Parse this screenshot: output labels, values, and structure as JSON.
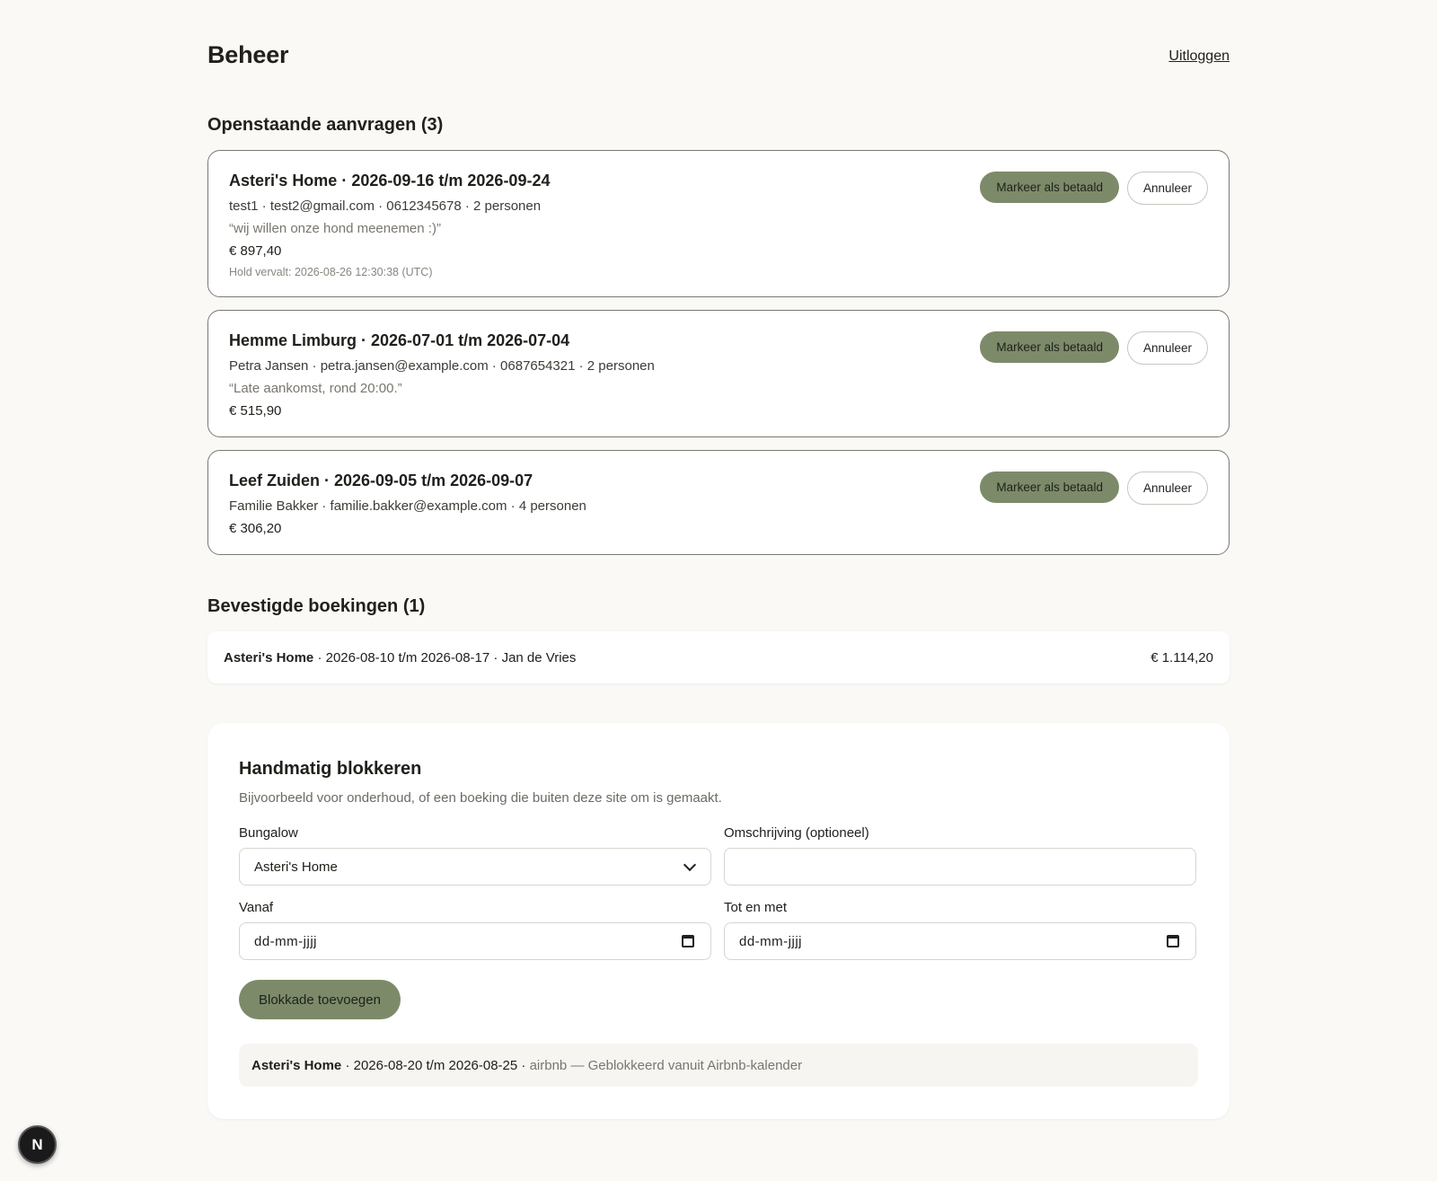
{
  "header": {
    "title": "Beheer",
    "logout_label": "Uitloggen"
  },
  "pending": {
    "title": "Openstaande aanvragen (3)",
    "mark_paid_label": "Markeer als betaald",
    "cancel_label": "Annuleer",
    "items": [
      {
        "title": "Asteri's Home · 2026-09-16 t/m 2026-09-24",
        "contact": "test1 · test2@gmail.com · 0612345678 · 2 personen",
        "note": "“wij willen onze hond meenemen :)”",
        "price": "€ 897,40",
        "hold": "Hold vervalt: 2026-08-26 12:30:38 (UTC)"
      },
      {
        "title": "Hemme Limburg · 2026-07-01 t/m 2026-07-04",
        "contact": "Petra Jansen · petra.jansen@example.com · 0687654321 · 2 personen",
        "note": "“Late aankomst, rond 20:00.”",
        "price": "€ 515,90"
      },
      {
        "title": "Leef Zuiden · 2026-09-05 t/m 2026-09-07",
        "contact": "Familie Bakker · familie.bakker@example.com · 4 personen",
        "price": "€ 306,20"
      }
    ]
  },
  "confirmed": {
    "title": "Bevestigde boekingen (1)",
    "items": [
      {
        "name": "Asteri's Home",
        "details": " · 2026-08-10 t/m 2026-08-17 · Jan de Vries",
        "price": "€ 1.114,20"
      }
    ]
  },
  "block": {
    "title": "Handmatig blokkeren",
    "description": "Bijvoorbeeld voor onderhoud, of een boeking die buiten deze site om is gemaakt.",
    "bungalow_label": "Bungalow",
    "bungalow_value": "Asteri's Home",
    "description_label": "Omschrijving (optioneel)",
    "description_value": "",
    "from_label": "Vanaf",
    "from_placeholder": "dd-mm-jjjj",
    "to_label": "Tot en met",
    "to_placeholder": "dd-mm-jjjj",
    "add_label": "Blokkade toevoegen",
    "items": [
      {
        "name": "Asteri's Home",
        "dates": " · 2026-08-20 t/m 2026-08-25 · ",
        "source": "airbnb — Geblokkeerd vanuit Airbnb-kalender"
      }
    ]
  },
  "badge": {
    "letter": "N"
  },
  "colors": {
    "accent": "#7d8a6a",
    "background": "#faf9f6"
  }
}
